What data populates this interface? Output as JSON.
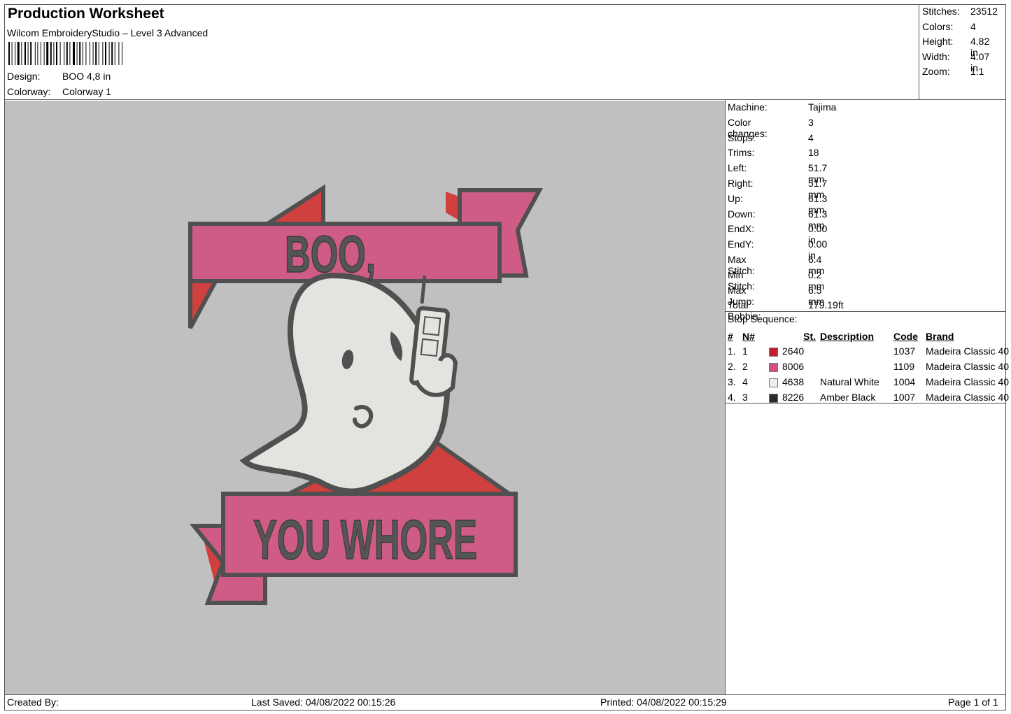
{
  "header": {
    "title": "Production Worksheet",
    "software": "Wilcom EmbroideryStudio – Level 3 Advanced",
    "design_label": "Design:",
    "design_value": "BOO 4,8 in",
    "colorway_label": "Colorway:",
    "colorway_value": "Colorway 1"
  },
  "summary": {
    "stitches_label": "Stitches:",
    "stitches": "23512",
    "colors_label": "Colors:",
    "colors": "4",
    "height_label": "Height:",
    "height": "4.82 in",
    "width_label": "Width:",
    "width": "4.07 in",
    "zoom_label": "Zoom:",
    "zoom": "1:1"
  },
  "machine": {
    "rows": [
      {
        "label": "Machine:",
        "value": "Tajima"
      },
      {
        "label": "Color changes:",
        "value": "3"
      },
      {
        "label": "Stops:",
        "value": "4"
      },
      {
        "label": "Trims:",
        "value": "18"
      },
      {
        "label": "Left:",
        "value": "51.7 mm"
      },
      {
        "label": "Right:",
        "value": "51.7 mm"
      },
      {
        "label": "Up:",
        "value": "61.3 mm"
      },
      {
        "label": "Down:",
        "value": "61.3 mm"
      },
      {
        "label": "EndX:",
        "value": "0.00 in"
      },
      {
        "label": "EndY:",
        "value": "0.00 in"
      },
      {
        "label": "Max Stitch:",
        "value": "6.4 mm"
      },
      {
        "label": "Min Stitch:",
        "value": "0.2 mm"
      },
      {
        "label": "Max Jump:",
        "value": "6.5 mm"
      },
      {
        "label": "Total Bobbin:",
        "value": "179.19ft"
      }
    ]
  },
  "stop_sequence": {
    "title": "Stop Sequence:",
    "headers": [
      "#",
      "N#",
      "St.",
      "Description",
      "Code",
      "Brand"
    ],
    "rows": [
      {
        "idx": "1.",
        "n": "1",
        "color": "#c41e2e",
        "st": "2640",
        "desc": "",
        "code": "1037",
        "brand": "Madeira Classic 40"
      },
      {
        "idx": "2.",
        "n": "2",
        "color": "#d44f86",
        "st": "8006",
        "desc": "",
        "code": "1109",
        "brand": "Madeira Classic 40"
      },
      {
        "idx": "3.",
        "n": "4",
        "color": "#eeeeee",
        "st": "4638",
        "desc": "Natural White",
        "code": "1004",
        "brand": "Madeira Classic 40"
      },
      {
        "idx": "4.",
        "n": "3",
        "color": "#2b2b2b",
        "st": "8226",
        "desc": "Amber Black",
        "code": "1007",
        "brand": "Madeira Classic 40"
      }
    ]
  },
  "design_art": {
    "top_text": "BOO,",
    "bottom_text": "YOU WHORE",
    "colors": {
      "red": "#d0403f",
      "pink": "#cf5c86",
      "white": "#e2e4df",
      "outline": "#505050",
      "background": "#c0c0c0"
    }
  },
  "footer": {
    "created_by": "Created By:",
    "last_saved": "Last Saved: 04/08/2022 00:15:26",
    "printed": "Printed: 04/08/2022 00:15:29",
    "page": "Page 1 of 1"
  }
}
